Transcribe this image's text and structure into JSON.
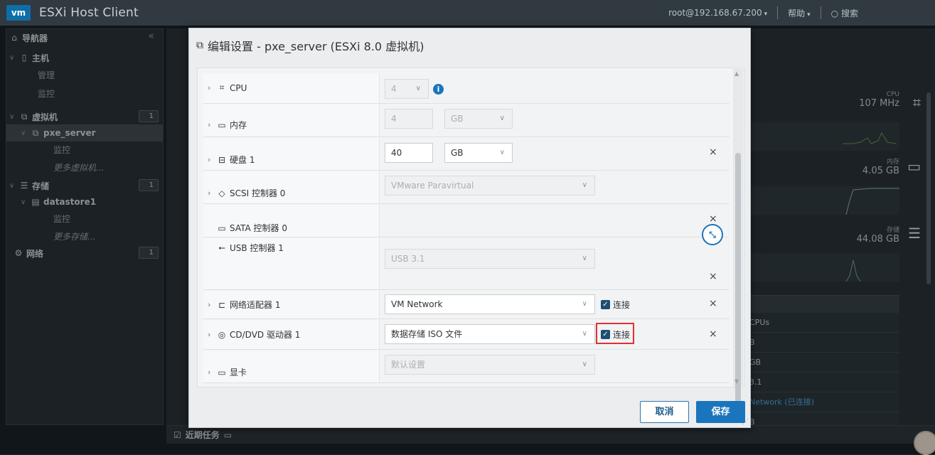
{
  "app": {
    "logo": "vm",
    "title": "ESXi Host Client",
    "user": "root@192.168.67.200",
    "help": "帮助",
    "search": "搜索"
  },
  "navigator": {
    "title": "导航器",
    "items": [
      {
        "label": "主机"
      },
      {
        "label": "管理"
      },
      {
        "label": "监控"
      },
      {
        "label": "虚拟机",
        "count": "1"
      },
      {
        "label": "pxe_server"
      },
      {
        "label": "监控"
      },
      {
        "label": "更多虚拟机..."
      },
      {
        "label": "存储",
        "count": "1"
      },
      {
        "label": "datastore1"
      },
      {
        "label": "监控"
      },
      {
        "label": "更多存储..."
      },
      {
        "label": "网络",
        "count": "1"
      }
    ]
  },
  "background_panel": {
    "cpu_label": "CPU",
    "cpu_value": "107 MHz",
    "mem_label": "内存",
    "mem_value": "4.05 GB",
    "storage_label": "存储",
    "storage_value": "44.08 GB",
    "rows": [
      "CPUs",
      "B",
      "GB",
      "3.1",
      "Network (已连接)",
      "B"
    ]
  },
  "bottom": {
    "recent_tasks": "近期任务"
  },
  "modal": {
    "title": "编辑设置 - pxe_server (ESXi 8.0 虚拟机)",
    "rows": {
      "cpu": {
        "label": "CPU",
        "value": "4"
      },
      "memory": {
        "label": "内存",
        "value": "4",
        "unit": "GB"
      },
      "disk": {
        "label": "硬盘 1",
        "value": "40",
        "unit": "GB"
      },
      "scsi": {
        "label": "SCSI 控制器 0",
        "value": "VMware Paravirtual"
      },
      "sata": {
        "label": "SATA 控制器 0"
      },
      "usb": {
        "label": "USB 控制器 1",
        "value": "USB 3.1"
      },
      "network": {
        "label": "网络适配器 1",
        "value": "VM Network",
        "connect": "连接"
      },
      "cdrom": {
        "label": "CD/DVD 驱动器 1",
        "value": "数据存储 ISO 文件",
        "connect": "连接"
      },
      "video": {
        "label": "显卡",
        "value": "默认设置"
      }
    },
    "cancel": "取消",
    "save": "保存"
  }
}
